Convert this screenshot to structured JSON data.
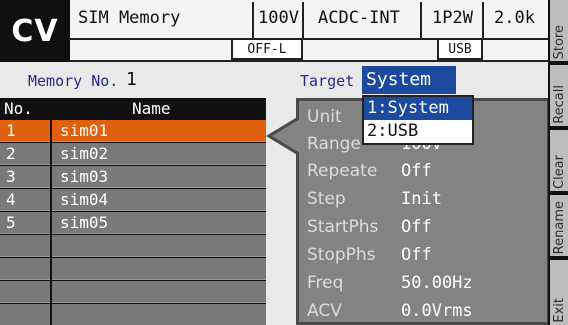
{
  "header": {
    "mode": "CV",
    "title": "SIM Memory",
    "voltage_range": "100V",
    "output_mode": "ACDC-INT",
    "wiring": "1P2W",
    "frequency": "2.0k",
    "output_status": "OFF-L",
    "interface": "USB"
  },
  "memory": {
    "label": "Memory No.",
    "value": "1"
  },
  "target": {
    "label": "Target",
    "value": "System",
    "options": [
      "1:System",
      "2:USB"
    ],
    "selected_index": 0
  },
  "table": {
    "col_no": "No.",
    "col_name": "Name",
    "rows": [
      {
        "no": "1",
        "name": "sim01",
        "selected": true
      },
      {
        "no": "2",
        "name": "sim02",
        "selected": false
      },
      {
        "no": "3",
        "name": "sim03",
        "selected": false
      },
      {
        "no": "4",
        "name": "sim04",
        "selected": false
      },
      {
        "no": "5",
        "name": "sim05",
        "selected": false
      }
    ],
    "empty_rows": 4
  },
  "detail": {
    "unit_label": "Unit",
    "unit_value": "",
    "range_label": "Range",
    "range_value": "100V",
    "repeat_label": "Repeate",
    "repeat_value": "Off",
    "step_label": "Step",
    "step_value": "Init",
    "startphs_label": "StartPhs",
    "startphs_value": "Off",
    "stopphs_label": "StopPhs",
    "stopphs_value": "Off",
    "freq_label": "Freq",
    "freq_value": "50.00Hz",
    "acv_label": "ACV",
    "acv_value": "0.0Vrms"
  },
  "softkeys": {
    "store": "Store",
    "recall": "Recall",
    "clear": "Clear",
    "rename": "Rename",
    "exit": "Exit"
  },
  "colors": {
    "mode_bg": "#101010",
    "selection": "#e06010",
    "highlight": "#1c4a9e",
    "table_row": "#7a7a7a",
    "panel": "#838383"
  }
}
